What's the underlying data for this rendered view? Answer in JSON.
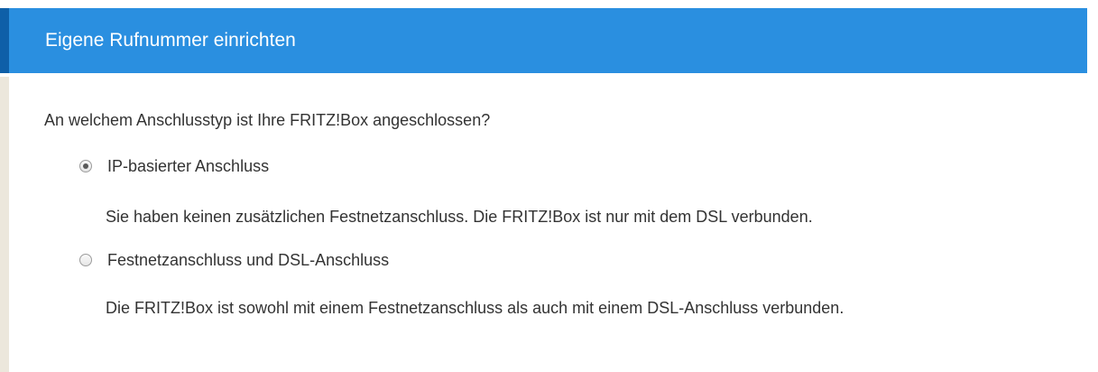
{
  "header": {
    "title": "Eigene Rufnummer einrichten",
    "background_color": "#2a8fe0",
    "accent_color": "#0e5fa8"
  },
  "form": {
    "question": "An welchem Anschlusstyp ist Ihre FRITZ!Box angeschlossen?",
    "options": [
      {
        "label": "IP-basierter Anschluss",
        "checked": true,
        "description": "Sie haben keinen zusätzlichen Festnetzanschluss. Die FRITZ!Box ist nur mit dem DSL verbunden."
      },
      {
        "label": "Festnetzanschluss und DSL-Anschluss",
        "checked": false,
        "description": "Die FRITZ!Box ist sowohl mit einem Festnetzanschluss als auch mit einem DSL-Anschluss verbunden."
      }
    ]
  }
}
